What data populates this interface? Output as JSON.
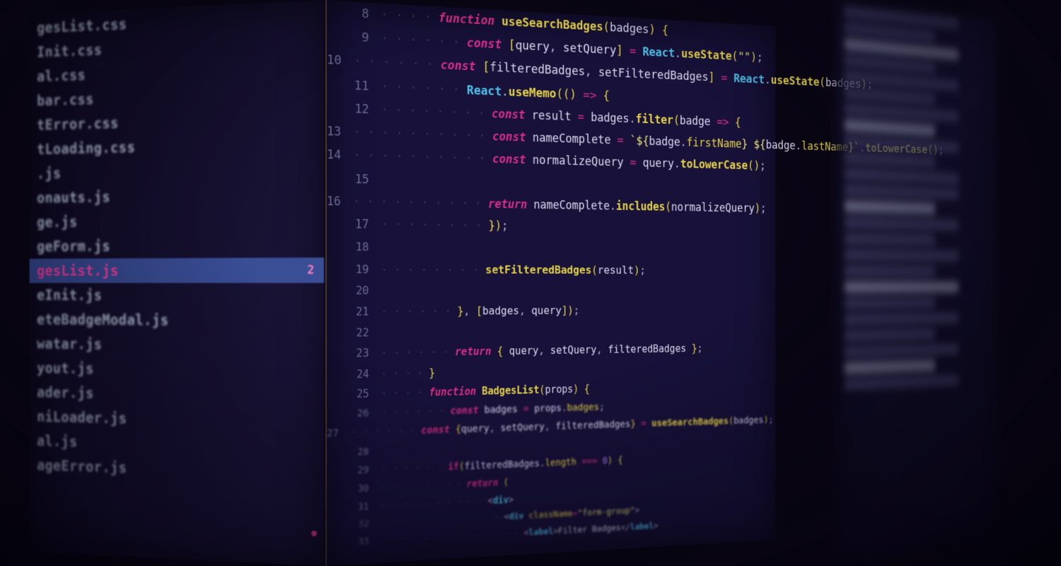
{
  "sidebar": {
    "files": [
      {
        "name": "gesList.css",
        "active": false
      },
      {
        "name": "Init.css",
        "active": false
      },
      {
        "name": "al.css",
        "active": false
      },
      {
        "name": "bar.css",
        "active": false
      },
      {
        "name": "tError.css",
        "active": false
      },
      {
        "name": "tLoading.css",
        "active": false
      },
      {
        "name": ".js",
        "active": false
      },
      {
        "name": "onauts.js",
        "active": false
      },
      {
        "name": "ge.js",
        "active": false
      },
      {
        "name": "geForm.js",
        "active": false
      },
      {
        "name": "gesList.js",
        "active": true,
        "badge": "2"
      },
      {
        "name": "eInit.js",
        "active": false
      },
      {
        "name": "eteBadgeModal.js",
        "active": false
      },
      {
        "name": "watar.js",
        "active": false
      },
      {
        "name": "yout.js",
        "active": false
      },
      {
        "name": "ader.js",
        "active": false
      },
      {
        "name": "niLoader.js",
        "active": false
      },
      {
        "name": "al.js",
        "active": false
      },
      {
        "name": "ageError.js",
        "active": false
      }
    ]
  },
  "editor": {
    "lines": [
      {
        "n": 8,
        "dots": 2,
        "tokens": [
          [
            "kw",
            "function "
          ],
          [
            "fn",
            "useSearchBadges"
          ],
          [
            "paren",
            "("
          ],
          [
            "var",
            "badges"
          ],
          [
            "paren",
            ") "
          ],
          [
            "brace",
            "{"
          ]
        ]
      },
      {
        "n": 9,
        "dots": 3,
        "tokens": [
          [
            "kw",
            "const "
          ],
          [
            "brack",
            "["
          ],
          [
            "var",
            "query"
          ],
          [
            "pun",
            ", "
          ],
          [
            "var",
            "setQuery"
          ],
          [
            "brack",
            "] "
          ],
          [
            "op",
            "= "
          ],
          [
            "type",
            "React"
          ],
          [
            "pun",
            "."
          ],
          [
            "fn",
            "useState"
          ],
          [
            "paren",
            "("
          ],
          [
            "str",
            "\"\""
          ],
          [
            "paren",
            ")"
          ],
          [
            "pun",
            ";"
          ]
        ]
      },
      {
        "n": 10,
        "dots": 3,
        "tokens": [
          [
            "kw",
            "const "
          ],
          [
            "brack",
            "["
          ],
          [
            "var",
            "filteredBadges"
          ],
          [
            "pun",
            ", "
          ],
          [
            "var",
            "setFilteredBadges"
          ],
          [
            "brack",
            "] "
          ],
          [
            "op",
            "= "
          ],
          [
            "type",
            "React"
          ],
          [
            "pun",
            "."
          ],
          [
            "fn",
            "useState"
          ],
          [
            "paren",
            "("
          ],
          [
            "var",
            "badges"
          ],
          [
            "paren",
            ")"
          ],
          [
            "pun",
            ";"
          ]
        ]
      },
      {
        "n": 11,
        "dots": 3,
        "tokens": [
          [
            "type",
            "React"
          ],
          [
            "pun",
            "."
          ],
          [
            "fn",
            "useMemo"
          ],
          [
            "paren",
            "(() "
          ],
          [
            "arrow",
            "=> "
          ],
          [
            "brace",
            "{"
          ]
        ]
      },
      {
        "n": 12,
        "dots": 4,
        "tokens": [
          [
            "kw",
            "const "
          ],
          [
            "var",
            "result "
          ],
          [
            "op",
            "= "
          ],
          [
            "var",
            "badges"
          ],
          [
            "pun",
            "."
          ],
          [
            "fn",
            "filter"
          ],
          [
            "paren",
            "("
          ],
          [
            "var",
            "badge "
          ],
          [
            "arrow",
            "=> "
          ],
          [
            "brace",
            "{"
          ]
        ]
      },
      {
        "n": 13,
        "dots": 5,
        "tokens": [
          [
            "kw",
            "const "
          ],
          [
            "var",
            "nameComplete "
          ],
          [
            "op",
            "= "
          ],
          [
            "str",
            "`${"
          ],
          [
            "var",
            "badge"
          ],
          [
            "pun",
            "."
          ],
          [
            "prop",
            "firstName"
          ],
          [
            "str",
            "} ${"
          ],
          [
            "var",
            "badge"
          ],
          [
            "pun",
            "."
          ],
          [
            "prop",
            "lastName"
          ],
          [
            "str",
            "}`"
          ],
          [
            "pun",
            "."
          ],
          [
            "fn",
            "toLowerCase"
          ],
          [
            "paren",
            "()"
          ],
          [
            "pun",
            ";"
          ]
        ]
      },
      {
        "n": 14,
        "dots": 5,
        "tokens": [
          [
            "kw",
            "const "
          ],
          [
            "var",
            "normalizeQuery "
          ],
          [
            "op",
            "= "
          ],
          [
            "var",
            "query"
          ],
          [
            "pun",
            "."
          ],
          [
            "fn",
            "toLowerCase"
          ],
          [
            "paren",
            "()"
          ],
          [
            "pun",
            ";"
          ]
        ]
      },
      {
        "n": 15,
        "dots": 0,
        "tokens": []
      },
      {
        "n": 16,
        "dots": 5,
        "tokens": [
          [
            "kw",
            "return "
          ],
          [
            "var",
            "nameComplete"
          ],
          [
            "pun",
            "."
          ],
          [
            "fn",
            "includes"
          ],
          [
            "paren",
            "("
          ],
          [
            "var",
            "normalizeQuery"
          ],
          [
            "paren",
            ")"
          ],
          [
            "pun",
            ";"
          ]
        ]
      },
      {
        "n": 17,
        "dots": 4,
        "tokens": [
          [
            "brace",
            "}"
          ],
          [
            "paren",
            ")"
          ],
          [
            "pun",
            ";"
          ]
        ]
      },
      {
        "n": 18,
        "dots": 0,
        "tokens": []
      },
      {
        "n": 19,
        "dots": 4,
        "tokens": [
          [
            "fn",
            "setFilteredBadges"
          ],
          [
            "paren",
            "("
          ],
          [
            "var",
            "result"
          ],
          [
            "paren",
            ")"
          ],
          [
            "pun",
            ";"
          ]
        ]
      },
      {
        "n": 20,
        "dots": 0,
        "tokens": []
      },
      {
        "n": 21,
        "dots": 3,
        "tokens": [
          [
            "brace",
            "}"
          ],
          [
            "pun",
            ", "
          ],
          [
            "brack",
            "["
          ],
          [
            "var",
            "badges"
          ],
          [
            "pun",
            ", "
          ],
          [
            "var",
            "query"
          ],
          [
            "brack",
            "]"
          ],
          [
            "paren",
            ")"
          ],
          [
            "pun",
            ";"
          ]
        ]
      },
      {
        "n": 22,
        "dots": 0,
        "tokens": []
      },
      {
        "n": 23,
        "dots": 3,
        "tokens": [
          [
            "kw",
            "return "
          ],
          [
            "brace",
            "{ "
          ],
          [
            "var",
            "query"
          ],
          [
            "pun",
            ", "
          ],
          [
            "var",
            "setQuery"
          ],
          [
            "pun",
            ", "
          ],
          [
            "var",
            "filteredBadges "
          ],
          [
            "brace",
            "}"
          ],
          [
            "pun",
            ";"
          ]
        ]
      },
      {
        "n": 24,
        "dots": 2,
        "tokens": [
          [
            "brace",
            "}"
          ]
        ]
      },
      {
        "n": 25,
        "dots": 2,
        "tokens": [
          [
            "kw",
            "function "
          ],
          [
            "fn",
            "BadgesList"
          ],
          [
            "paren",
            "("
          ],
          [
            "var",
            "props"
          ],
          [
            "paren",
            ") "
          ],
          [
            "brace",
            "{"
          ]
        ]
      },
      {
        "n": 26,
        "dots": 3,
        "tokens": [
          [
            "kw",
            "const "
          ],
          [
            "var",
            "badges "
          ],
          [
            "op",
            "= "
          ],
          [
            "var",
            "props"
          ],
          [
            "pun",
            "."
          ],
          [
            "prop",
            "badges"
          ],
          [
            "pun",
            ";"
          ]
        ]
      },
      {
        "n": 27,
        "dots": 3,
        "tokens": [
          [
            "kw",
            "const "
          ],
          [
            "brace",
            "{"
          ],
          [
            "var",
            "query"
          ],
          [
            "pun",
            ", "
          ],
          [
            "var",
            "setQuery"
          ],
          [
            "pun",
            ", "
          ],
          [
            "var",
            "filteredBadges"
          ],
          [
            "brace",
            "} "
          ],
          [
            "op",
            "= "
          ],
          [
            "fn",
            "useSearchBadges"
          ],
          [
            "paren",
            "("
          ],
          [
            "var",
            "badges"
          ],
          [
            "paren",
            ")"
          ],
          [
            "pun",
            ";"
          ]
        ]
      },
      {
        "n": 28,
        "dots": 0,
        "tokens": []
      },
      {
        "n": 29,
        "dots": 3,
        "tokens": [
          [
            "kw2",
            "if"
          ],
          [
            "paren",
            "("
          ],
          [
            "var",
            "filteredBadges"
          ],
          [
            "pun",
            "."
          ],
          [
            "prop",
            "length "
          ],
          [
            "op",
            "=== "
          ],
          [
            "num",
            "0"
          ],
          [
            "paren",
            ") "
          ],
          [
            "brace",
            "{"
          ]
        ]
      },
      {
        "n": 30,
        "dots": 4,
        "tokens": [
          [
            "kw",
            "return "
          ],
          [
            "paren",
            "("
          ]
        ]
      },
      {
        "n": 31,
        "dots": 5,
        "tokens": [
          [
            "pun",
            "<"
          ],
          [
            "type",
            "div"
          ],
          [
            "pun",
            ">"
          ]
        ]
      },
      {
        "n": 32,
        "dots": 6,
        "tokens": [
          [
            "pun",
            "<"
          ],
          [
            "type",
            "div "
          ],
          [
            "prop",
            "className"
          ],
          [
            "op",
            "="
          ],
          [
            "str",
            "\"form-group\""
          ],
          [
            "pun",
            ">"
          ]
        ]
      },
      {
        "n": 33,
        "dots": 7,
        "tokens": [
          [
            "pun",
            "<"
          ],
          [
            "type",
            "label"
          ],
          [
            "pun",
            ">"
          ],
          [
            "var",
            "Filter Badges"
          ],
          [
            "pun",
            "</"
          ],
          [
            "type",
            "label"
          ],
          [
            "pun",
            ">"
          ]
        ]
      }
    ]
  }
}
